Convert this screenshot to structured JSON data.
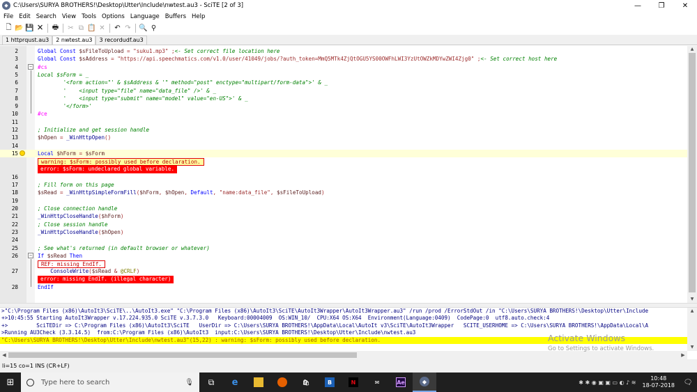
{
  "window": {
    "title": "C:\\Users\\SURYA BROTHERS!\\Desktop\\Utter\\Include\\nwtest.au3 - SciTE [2 of 3]",
    "minimize": "—",
    "maximize": "❐",
    "close": "✕"
  },
  "menu": [
    "File",
    "Edit",
    "Search",
    "View",
    "Tools",
    "Options",
    "Language",
    "Buffers",
    "Help"
  ],
  "toolbar_icons": [
    "new-file-icon",
    "open-folder-icon",
    "save-icon",
    "close-file-icon",
    "print-icon",
    "cut-icon",
    "copy-icon",
    "paste-icon",
    "delete-icon",
    "undo-icon",
    "redo-icon",
    "find-icon",
    "replace-icon"
  ],
  "tabs": [
    "1 httprqust.au3",
    "2 nwtest.au3",
    "3 recordudf.au3"
  ],
  "active_tab": 1,
  "code_lines": [
    {
      "n": "2",
      "parts": [
        [
          "kw",
          "Global Const "
        ],
        [
          "var",
          "$sFileToUpload"
        ],
        [
          "op",
          " = "
        ],
        [
          "str",
          "\"suku1.mp3\""
        ],
        [
          "op",
          " ;"
        ],
        [
          "cm",
          "<- Set correct file location here"
        ]
      ]
    },
    {
      "n": "3",
      "parts": [
        [
          "kw",
          "Global Const "
        ],
        [
          "var",
          "$sAddress"
        ],
        [
          "op",
          " = "
        ],
        [
          "str",
          "\"https://api.speechmatics.com/v1.0/user/41049/jobs/?auth_token=MmQ5MTk4ZjQtOGU5YS00OWFhLWI3YzUtOWZkMDYwZWI4Zjg0\""
        ],
        [
          "op",
          " ;"
        ],
        [
          "cm",
          "<- Set correct host here"
        ]
      ]
    },
    {
      "n": "4",
      "parts": [
        [
          "dir",
          "#cs"
        ]
      ]
    },
    {
      "n": "5",
      "parts": [
        [
          "cm",
          "Local $sForm = _"
        ]
      ]
    },
    {
      "n": "6",
      "parts": [
        [
          "cm",
          "        '<form action=\"' & $sAddress & '\" method=\"post\" enctype=\"multipart/form-data\">' & _"
        ]
      ]
    },
    {
      "n": "7",
      "parts": [
        [
          "cm",
          "        '    <input type=\"file\" name=\"data_file\" />' & _"
        ]
      ]
    },
    {
      "n": "8",
      "parts": [
        [
          "cm",
          "        '    <input type=\"submit\" name=\"model\" value=\"en-US\">' & _"
        ]
      ]
    },
    {
      "n": "9",
      "parts": [
        [
          "cm",
          "        '</form>'"
        ]
      ]
    },
    {
      "n": "10",
      "parts": [
        [
          "dir",
          "#ce"
        ]
      ]
    },
    {
      "n": "11",
      "parts": []
    },
    {
      "n": "12",
      "parts": [
        [
          "cm",
          "; Initialize and get session handle"
        ]
      ]
    },
    {
      "n": "13",
      "parts": [
        [
          "var",
          "$hOpen"
        ],
        [
          "op",
          " = "
        ],
        [
          "fn",
          "_WinHttpOpen"
        ],
        [
          "op",
          "()"
        ]
      ]
    },
    {
      "n": "14",
      "parts": []
    },
    {
      "n": "15",
      "parts": [
        [
          "kw",
          "Local "
        ],
        [
          "var",
          "$hForm"
        ],
        [
          "op",
          " = "
        ],
        [
          "var",
          "$sForm"
        ]
      ]
    },
    {
      "n": "",
      "annot": "warn",
      "text": "warning: $sForm: possibly used before declaration."
    },
    {
      "n": "",
      "annot": "err",
      "text": "error: $sForm: undeclared global variable."
    },
    {
      "n": "16",
      "parts": []
    },
    {
      "n": "17",
      "parts": [
        [
          "cm",
          "; Fill form on this page"
        ]
      ]
    },
    {
      "n": "18",
      "parts": [
        [
          "var",
          "$sRead"
        ],
        [
          "op",
          " = "
        ],
        [
          "fn",
          "_WinHttpSimpleFormFill"
        ],
        [
          "op",
          "("
        ],
        [
          "var",
          "$hForm"
        ],
        [
          "op",
          ", "
        ],
        [
          "var",
          "$hOpen"
        ],
        [
          "op",
          ", "
        ],
        [
          "kw",
          "Default"
        ],
        [
          "op",
          ", "
        ],
        [
          "str",
          "\"name:data_file\""
        ],
        [
          "op",
          ", "
        ],
        [
          "var",
          "$sFileToUpload"
        ],
        [
          "op",
          ")"
        ]
      ]
    },
    {
      "n": "19",
      "parts": []
    },
    {
      "n": "20",
      "parts": [
        [
          "cm",
          "; Close connection handle"
        ]
      ]
    },
    {
      "n": "21",
      "parts": [
        [
          "fn",
          "_WinHttpCloseHandle"
        ],
        [
          "op",
          "("
        ],
        [
          "var",
          "$hForm"
        ],
        [
          "op",
          ")"
        ]
      ]
    },
    {
      "n": "22",
      "parts": [
        [
          "cm",
          "; Close session handle"
        ]
      ]
    },
    {
      "n": "23",
      "parts": [
        [
          "fn",
          "_WinHttpCloseHandle"
        ],
        [
          "op",
          "("
        ],
        [
          "var",
          "$hOpen"
        ],
        [
          "op",
          ")"
        ]
      ]
    },
    {
      "n": "24",
      "parts": []
    },
    {
      "n": "25",
      "parts": [
        [
          "cm",
          "; See what's returned (in default browser or whatever)"
        ]
      ]
    },
    {
      "n": "26",
      "parts": [
        [
          "kw",
          "If "
        ],
        [
          "var",
          "$sRead"
        ],
        [
          "kw",
          " Then"
        ]
      ]
    },
    {
      "n": "",
      "annot": "ref",
      "text": "REF: missing EndIf."
    },
    {
      "n": "27",
      "parts": [
        [
          "fn",
          "    ConsoleWrite"
        ],
        [
          "op",
          "("
        ],
        [
          "var",
          "$sRead"
        ],
        [
          "op",
          " & "
        ],
        [
          "mac",
          "@CRLF"
        ],
        [
          "op",
          ")"
        ]
      ]
    },
    {
      "n": "",
      "annot": "err",
      "text": "error: missing EndIf. (illegal character)"
    },
    {
      "n": "28",
      "parts": [
        [
          "kw",
          "EndIf"
        ]
      ]
    }
  ],
  "output_lines": [
    {
      "cls": "blue",
      "text": ">\"C:\\Program Files (x86)\\AutoIt3\\SciTE\\..\\AutoIt3.exe\" \"C:\\Program Files (x86)\\AutoIt3\\SciTE\\AutoIt3Wrapper\\AutoIt3Wrapper.au3\" /run /prod /ErrorStdOut /in \"C:\\Users\\SURYA BROTHERS!\\Desktop\\Utter\\Include"
    },
    {
      "cls": "blue",
      "text": "+>10:45:55 Starting AutoIt3Wrapper v.17.224.935.0 SciTE v.3.7.3.0   Keyboard:00004009  OS:WIN_10/  CPU:X64 OS:X64  Environment(Language:0409)  CodePage:0  utf8.auto.check:4"
    },
    {
      "cls": "blue",
      "text": "+>         SciTEDir => C:\\Program Files (x86)\\AutoIt3\\SciTE   UserDir => C:\\Users\\SURYA BROTHERS!\\AppData\\Local\\AutoIt v3\\SciTE\\AutoIt3Wrapper   SCITE_USERHOME => C:\\Users\\SURYA BROTHERS!\\AppData\\Local\\A"
    },
    {
      "cls": "blue",
      "text": ">Running AU3Check (3.3.14.5)  from:C:\\Program Files (x86)\\AutoIt3  input:C:\\Users\\SURYA BROTHERS!\\Desktop\\Utter\\Include\\nwtest.au3"
    },
    {
      "cls": "warn",
      "text": "\"C:\\Users\\SURYA BROTHERS!\\Desktop\\Utter\\Include\\nwtest.au3\"(15,22) : warning: $sForm: possibly used before declaration."
    }
  ],
  "watermark": {
    "line1": "Activate Windows",
    "line2": "Go to Settings to activate Windows."
  },
  "status": "li=15 co=1 INS (CR+LF)",
  "taskbar": {
    "search_placeholder": "Type here to search",
    "apps": [
      "task-view-icon",
      "edge-icon",
      "file-explorer-icon",
      "firefox-icon",
      "store-icon",
      "bitdefender-icon",
      "netflix-icon",
      "mail-icon",
      "after-effects-icon",
      "autoit-icon"
    ],
    "time": "10:48",
    "date": "18-07-2018"
  }
}
